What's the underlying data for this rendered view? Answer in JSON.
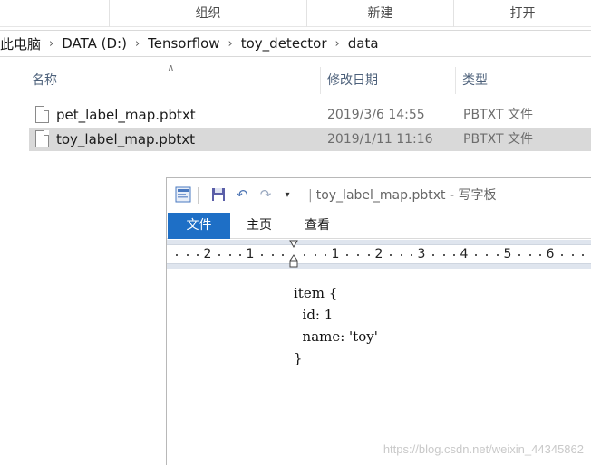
{
  "explorer": {
    "ribbon_groups": [
      "组织",
      "新建",
      "打开"
    ],
    "breadcrumb": [
      "此电脑",
      "DATA (D:)",
      "Tensorflow",
      "toy_detector",
      "data"
    ],
    "columns": {
      "name": "名称",
      "date": "修改日期",
      "type": "类型"
    },
    "files": [
      {
        "name": "pet_label_map.pbtxt",
        "date": "2019/3/6 14:55",
        "type": "PBTXT 文件",
        "selected": false
      },
      {
        "name": "toy_label_map.pbtxt",
        "date": "2019/1/11 11:16",
        "type": "PBTXT 文件",
        "selected": true
      }
    ]
  },
  "wordpad": {
    "title": "toy_label_map.pbtxt - 写字板",
    "tabs": [
      "文件",
      "主页",
      "查看"
    ],
    "ruler_labels": [
      "2",
      "1",
      "1",
      "2",
      "3",
      "4",
      "5",
      "6"
    ],
    "document_lines": [
      "item {",
      "  id: 1",
      "  name: 'toy'",
      "}"
    ]
  },
  "watermark": "https://blog.csdn.net/weixin_44345862",
  "colors": {
    "file_tab": "#1e6fc6",
    "selection": "#d9d9d9",
    "header_text": "#4c607a"
  },
  "icons": [
    "wordpad-app-icon",
    "save-icon",
    "undo-icon",
    "redo-icon",
    "qat-dropdown-icon",
    "file-icon",
    "sort-up-icon"
  ]
}
